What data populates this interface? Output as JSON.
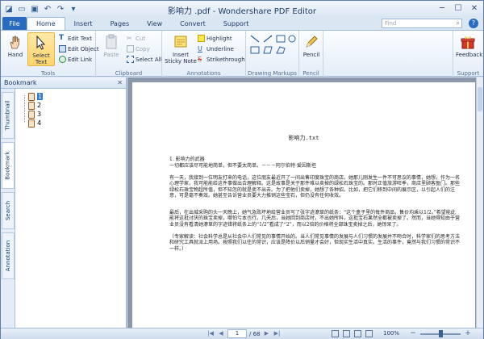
{
  "window": {
    "title": "影响力 .pdf - Wondershare PDF Editor"
  },
  "search": {
    "placeholder": "Find"
  },
  "tabs": {
    "file": "File",
    "items": [
      "Home",
      "Insert",
      "Pages",
      "View",
      "Convert",
      "Support"
    ],
    "active": "Home"
  },
  "ribbon": {
    "tools": {
      "label": "Tools",
      "hand": "Hand",
      "select_text": "Select Text",
      "edit_text": "Edit Text",
      "edit_object": "Edit Object",
      "edit_link": "Edit Link"
    },
    "clipboard": {
      "label": "Clipboard",
      "paste": "Paste",
      "cut": "Cut",
      "copy": "Copy",
      "select_all": "Select All"
    },
    "annotations": {
      "label": "Annotations",
      "sticky_note": "Insert Sticky Note",
      "highlight": "Highlight",
      "underline": "Underline",
      "strikethrough": "Strikethrough"
    },
    "drawing": {
      "label": "Drawing Markups"
    },
    "pencil": {
      "label": "Pencil",
      "button": "Pencil"
    },
    "support": {
      "label": "Support",
      "feedback": "Feedback"
    }
  },
  "bookmark_panel": {
    "title": "Bookmark",
    "side_tabs": [
      "Thumbnail",
      "Bookmark",
      "Search",
      "Annotation"
    ],
    "items": [
      "1",
      "2",
      "3",
      "4"
    ],
    "selected": "1"
  },
  "document": {
    "title": "影响力.txt",
    "paragraphs": [
      "1. 影响力的武器",
      "一切都应该尽可能地简单，但不要太简单。－－－阿尔伯特·爱因斯坦",
      "有一天，我接到一位明友打来的电话，这位朋友最近开了一间出售印度珠宝的商店。她那儿刚发生一件不可思议的事情，她想，作为一名心理学家，我可能能给这件事做出合理解释。这是故事是关于那件难以卖掉的绿松石珠宝的。那时正值旅游旺季，商店里顾客盈门。那些绿松石珠宝物超所值，但不知怎的就是卖不出去。为了把他们卖掉，她想了各种招，比如，把它们移到中间的展示区，以引起人们的注意，可是毫不奏效。她甚至告诉营业员要大力推销这些宝石，但仍没有任何收效。",
      "最后，在出城采购的头一天晚上，她气急败坏地给营业员写了张字迹潦草的纸条：“这个盒子里的每件商品，售价均乘以1/2。”希望能此能将这批讨厌的珠宝卖掉，哪怕亏本也行。几天后，当她回到商店时，不出她所料，这批宝石果然全都被卖掉了。然而，当她得知由于营业员没有看清她潦草的字迹错将纸条上的“1/2”看成了“2”，而以2倍的价格将全部珠宝卖掉之后，她惊呆了。",
      "〔专家解读：社会科学总是从社会中人们常见的事情开始的。当人们常见事情的发展与人们习惯的发展并不吻合时，科学家们的思考方法和研究工具就派上用场。按照我们以往的常识，应该是降价以后销量才会好，但现实生活中真实。生活的事件，竟然与我们习惯的常识不一样。〕"
    ]
  },
  "status": {
    "page_current": "1",
    "page_total": "/ 68",
    "zoom": "100%"
  }
}
